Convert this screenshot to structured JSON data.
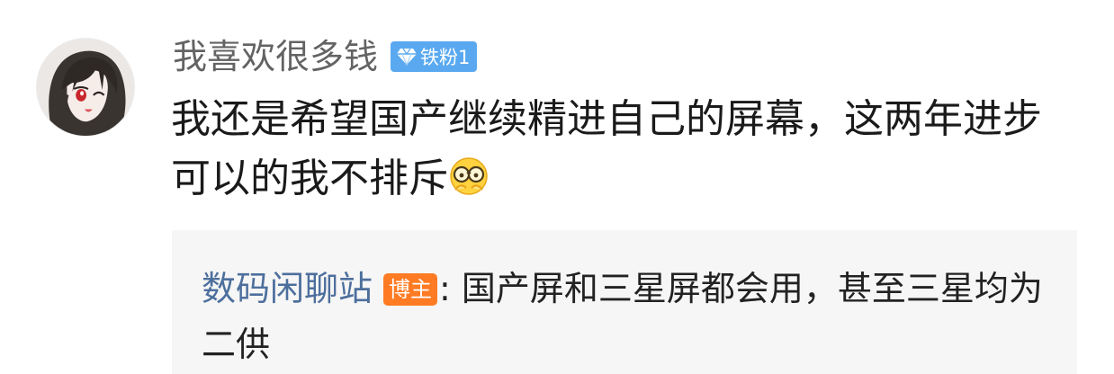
{
  "comment": {
    "username": "我喜欢很多钱",
    "fan_badge": {
      "label": "铁粉1",
      "icon": "diamond-icon",
      "color": "#5aa9f0"
    },
    "text": "我还是希望国产继续精进自己的屏幕，这两年进步可以的我不排斥",
    "emoji": "glasses-emoji-icon"
  },
  "reply": {
    "author": "数码闲聊站",
    "badge": "博主",
    "badge_color": "#ff7b23",
    "separator": ": ",
    "text": "国产屏和三星屏都会用，甚至三星均为二供"
  }
}
